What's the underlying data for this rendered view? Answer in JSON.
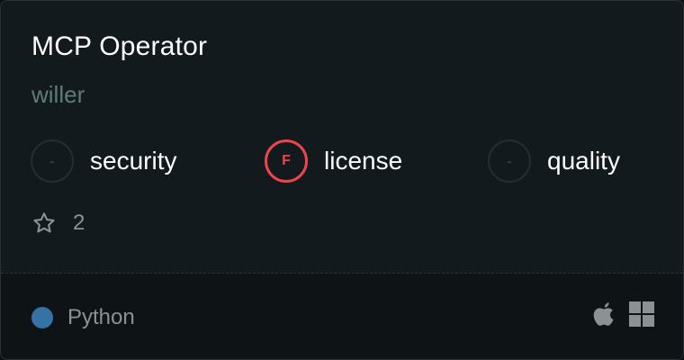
{
  "card": {
    "title": "MCP Operator",
    "author": "willer"
  },
  "scores": [
    {
      "grade": "-",
      "label": "security",
      "status": "none"
    },
    {
      "grade": "F",
      "label": "license",
      "status": "fail"
    },
    {
      "grade": "-",
      "label": "quality",
      "status": "none"
    }
  ],
  "stars": {
    "icon": "star-outline-icon",
    "count": "2"
  },
  "language": {
    "name": "Python",
    "color": "#3572a5"
  },
  "platforms": [
    {
      "icon": "apple-icon",
      "name": "macOS"
    },
    {
      "icon": "windows-icon",
      "name": "Windows"
    }
  ],
  "colors": {
    "fail": "#f0444d",
    "author": "#5f7c77",
    "background": "#121a1d"
  }
}
